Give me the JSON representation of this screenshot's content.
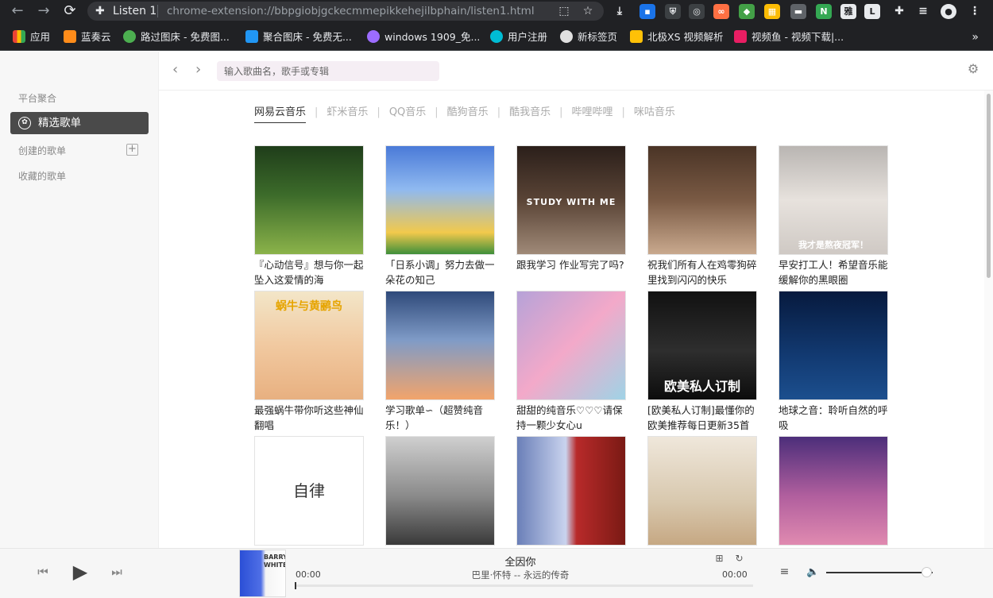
{
  "browser": {
    "tab_title": "Listen 1",
    "url": "chrome-extension://bbpgiobjgckecmmepikkehejilbphain/listen1.html",
    "bookmarks": [
      {
        "label": "应用",
        "color": "#e8453c"
      },
      {
        "label": "蓝奏云",
        "color": "#ff8c1a"
      },
      {
        "label": "路过图床 - 免费图...",
        "color": "#4caf50"
      },
      {
        "label": "聚合图床 - 免费无...",
        "color": "#2196f3"
      },
      {
        "label": "windows 1909_免...",
        "color": "#9c6cff"
      },
      {
        "label": "用户注册",
        "color": "#00bcd4"
      },
      {
        "label": "新标签页",
        "color": "#bdbdbd"
      },
      {
        "label": "北极XS 视频解析",
        "color": "#ffc107"
      },
      {
        "label": "视频鱼 - 视频下载|...",
        "color": "#e91e63"
      }
    ],
    "bookmarks_more": "»"
  },
  "sidebar": {
    "heading": "平台聚合",
    "active_item": "精选歌单",
    "created_label": "创建的歌单",
    "add_symbol": "+",
    "favorites_label": "收藏的歌单"
  },
  "topbar": {
    "back": "‹",
    "forward": "›",
    "search_placeholder": "输入歌曲名，歌手或专辑",
    "settings_icon": "gear-icon"
  },
  "tabs": [
    "网易云音乐",
    "虾米音乐",
    "QQ音乐",
    "酷狗音乐",
    "酷我音乐",
    "哔哩哔哩",
    "咪咕音乐"
  ],
  "active_tab": "网易云音乐",
  "playlists": [
    {
      "title": "『心动信号』想与你一起坠入这爱情的海",
      "cover_bg": "linear-gradient(180deg,#1f3d1a 0%,#3c6b2a 45%,#8bb34a 100%)",
      "cover_text": ""
    },
    {
      "title": "「日系小调」努力去做一朵花の知己",
      "cover_bg": "linear-gradient(180deg,#4a7ad8 0%,#8fb9f0 40%,#f2c94c 80%,#3e8f3a 100%)",
      "cover_text": ""
    },
    {
      "title": "跟我学习 作业写完了吗?",
      "cover_bg": "linear-gradient(180deg,#2b1f1a 0%,#5a4436 50%,#a08a78 100%)",
      "cover_text": "STUDY WITH ME"
    },
    {
      "title": "祝我们所有人在鸡零狗碎里找到闪闪的快乐",
      "cover_bg": "linear-gradient(180deg,#4a3426 0%,#7a5a44 50%,#c9a98e 100%)",
      "cover_text": ""
    },
    {
      "title": "早安打工人！希望音乐能缓解你的黑眼圈",
      "cover_bg": "linear-gradient(180deg,#b9b5b2 0%,#e7e2dd 50%,#cfc9c4 100%)",
      "cover_text": "我才是熬夜冠军！"
    },
    {
      "title": "最强蜗牛带你听这些神仙翻唱",
      "cover_bg": "linear-gradient(180deg,#f3e6c8 0%,#f1c9a0 50%,#e8b080 100%)",
      "cover_text": "蜗牛与黄鹂鸟"
    },
    {
      "title": "学习歌单∽（超赞纯音乐！）",
      "cover_bg": "linear-gradient(180deg,#2f4a7a 0%,#7f9bc7 45%,#f2a46b 100%)",
      "cover_text": ""
    },
    {
      "title": "甜甜的纯音乐♡♡♡请保持一颗少女心u",
      "cover_bg": "linear-gradient(135deg,#b6a2d8 0%,#f3a9c9 50%,#9fd3e6 100%)",
      "cover_text": ""
    },
    {
      "title": "[欧美私人订制]最懂你的欧美推荐每日更新35首",
      "cover_bg": "linear-gradient(180deg,#111 0%,#2e2e2e 55%,#0c0c0c 100%)",
      "cover_text": "欧美私人订制"
    },
    {
      "title": "地球之音：聆听自然的呼吸",
      "cover_bg": "linear-gradient(180deg,#071a3e 0%,#123a72 60%,#1c4f8e 100%)",
      "cover_text": ""
    },
    {
      "title": "",
      "cover_bg": "#ffffff",
      "cover_text": "自律"
    },
    {
      "title": "",
      "cover_bg": "linear-gradient(180deg,#cfcfcf 0%,#8a8a8a 55%,#3a3a3a 100%)",
      "cover_text": ""
    },
    {
      "title": "",
      "cover_bg": "linear-gradient(90deg,#6a7fb8 0%,#c9d3ee 45%,#b82a2a 55%,#7a1a14 100%)",
      "cover_text": ""
    },
    {
      "title": "",
      "cover_bg": "linear-gradient(180deg,#efe7db 0%,#d8c8ae 60%,#c6a883 100%)",
      "cover_text": ""
    },
    {
      "title": "",
      "cover_bg": "linear-gradient(180deg,#4c2e7a 0%,#b15f9e 55%,#e08ab0 100%)",
      "cover_text": ""
    }
  ],
  "player": {
    "song_title": "全因你",
    "artist_album": "巴里·怀特 -- 永远的传奇",
    "time_current": "00:00",
    "time_total": "00:00",
    "progress_fraction": 0,
    "volume_fraction": 0.94,
    "album_text": "BARRY WHITE"
  }
}
